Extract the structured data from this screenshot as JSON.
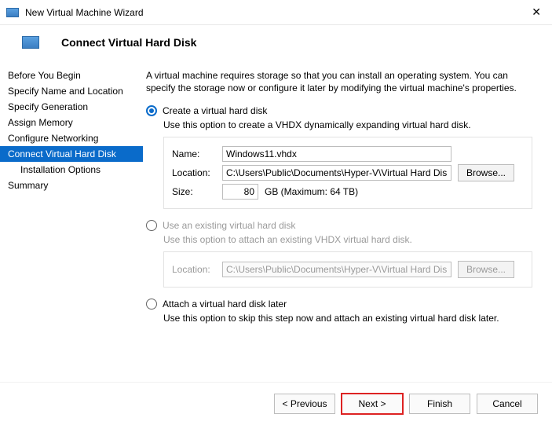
{
  "window": {
    "title": "New Virtual Machine Wizard"
  },
  "header": {
    "title": "Connect Virtual Hard Disk"
  },
  "sidebar": {
    "items": [
      {
        "label": "Before You Begin"
      },
      {
        "label": "Specify Name and Location"
      },
      {
        "label": "Specify Generation"
      },
      {
        "label": "Assign Memory"
      },
      {
        "label": "Configure Networking"
      },
      {
        "label": "Connect Virtual Hard Disk"
      },
      {
        "label": "Installation Options"
      },
      {
        "label": "Summary"
      }
    ]
  },
  "intro": "A virtual machine requires storage so that you can install an operating system. You can specify the storage now or configure it later by modifying the virtual machine's properties.",
  "opt_create": {
    "label": "Create a virtual hard disk",
    "desc": "Use this option to create a VHDX dynamically expanding virtual hard disk.",
    "name_lbl": "Name:",
    "name_val": "Windows11.vhdx",
    "loc_lbl": "Location:",
    "loc_val": "C:\\Users\\Public\\Documents\\Hyper-V\\Virtual Hard Disks\\",
    "size_lbl": "Size:",
    "size_val": "80",
    "size_unit": "GB (Maximum: 64 TB)",
    "browse": "Browse..."
  },
  "opt_existing": {
    "label": "Use an existing virtual hard disk",
    "desc": "Use this option to attach an existing VHDX virtual hard disk.",
    "loc_lbl": "Location:",
    "loc_val": "C:\\Users\\Public\\Documents\\Hyper-V\\Virtual Hard Disks\\",
    "browse": "Browse..."
  },
  "opt_later": {
    "label": "Attach a virtual hard disk later",
    "desc": "Use this option to skip this step now and attach an existing virtual hard disk later."
  },
  "footer": {
    "prev": "< Previous",
    "next": "Next >",
    "finish": "Finish",
    "cancel": "Cancel"
  }
}
